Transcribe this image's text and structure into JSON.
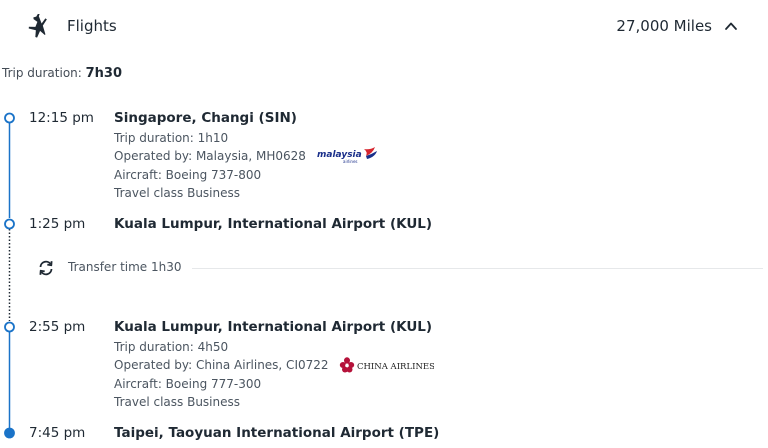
{
  "header": {
    "title": "Flights",
    "miles": "27,000 Miles"
  },
  "trip": {
    "label": "Trip duration: ",
    "duration": "7h30"
  },
  "segments": [
    {
      "dep_time": "12:15 pm",
      "dep_place": "Singapore, Changi (SIN)",
      "duration": "Trip duration: 1h10",
      "operated": "Operated by: Malaysia, MH0628",
      "aircraft": "Aircraft: Boeing 737-800",
      "class": "Travel class Business",
      "arr_time": "1:25 pm",
      "arr_place": "Kuala Lumpur, International Airport (KUL)",
      "airline_logo_text": "malaysia",
      "airline_logo_subtext": "airlines",
      "brand_color": "#1a2f8a"
    },
    {
      "dep_time": "2:55 pm",
      "dep_place": "Kuala Lumpur, International Airport (KUL)",
      "duration": "Trip duration: 4h50",
      "operated": "Operated by: China Airlines, CI0722",
      "aircraft": "Aircraft: Boeing 777-300",
      "class": "Travel class Business",
      "arr_time": "7:45 pm",
      "arr_place": "Taipei, Taoyuan International Airport (TPE)",
      "airline_logo_text": "CHINA AIRLINES",
      "brand_color": "#b5123a"
    }
  ],
  "transfer": {
    "text": "Transfer time 1h30"
  },
  "colors": {
    "timeline": "#1a73c8"
  }
}
